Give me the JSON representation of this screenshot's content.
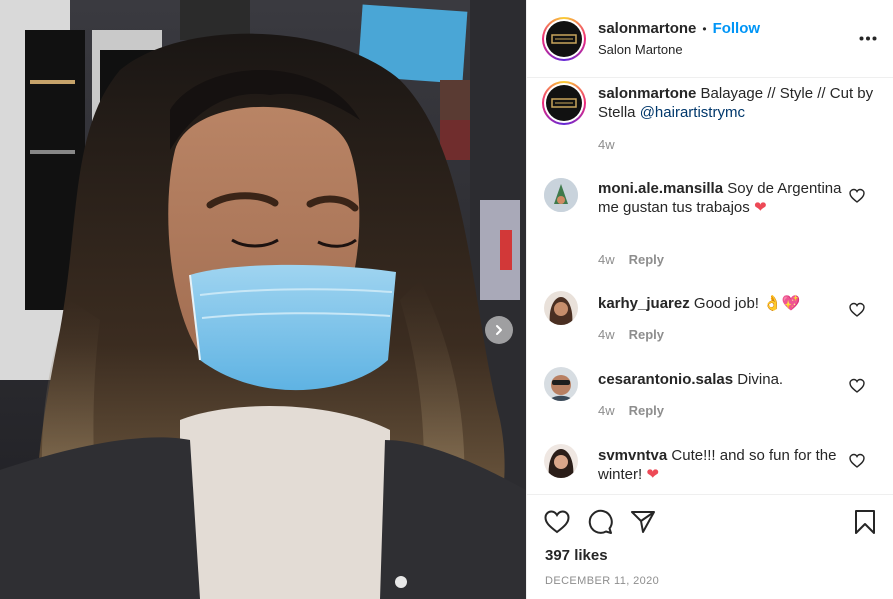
{
  "header": {
    "username": "salonmartone",
    "separator": "•",
    "follow_label": "Follow",
    "location": "Salon Martone",
    "more_icon": "more-horizontal-icon"
  },
  "caption": {
    "username": "salonmartone",
    "text": "Balayage // Style // Cut by Stella",
    "mention": "@hairartistrymc",
    "time": "4w"
  },
  "comments": [
    {
      "username": "moni.ale.mansilla",
      "text": "Soy de Argentina me gustan tus trabajos",
      "emoji": "❤",
      "time": "4w",
      "reply": "Reply"
    },
    {
      "username": "karhy_juarez",
      "text": "Good job!",
      "emoji": "👌💖",
      "time": "4w",
      "reply": "Reply"
    },
    {
      "username": "cesarantonio.salas",
      "text": "Divina.",
      "emoji": "",
      "time": "4w",
      "reply": "Reply"
    },
    {
      "username": "svmvntva",
      "text": "Cute!!! and so fun for the winter!",
      "emoji": "❤",
      "time": "",
      "reply": ""
    }
  ],
  "actions": {
    "likes": "397 likes",
    "date": "DECEMBER 11, 2020"
  },
  "colors": {
    "follow_blue": "#0095f6",
    "mention_blue": "#00376b",
    "heart_red": "#ed4956",
    "muted": "#8e8e8e"
  }
}
